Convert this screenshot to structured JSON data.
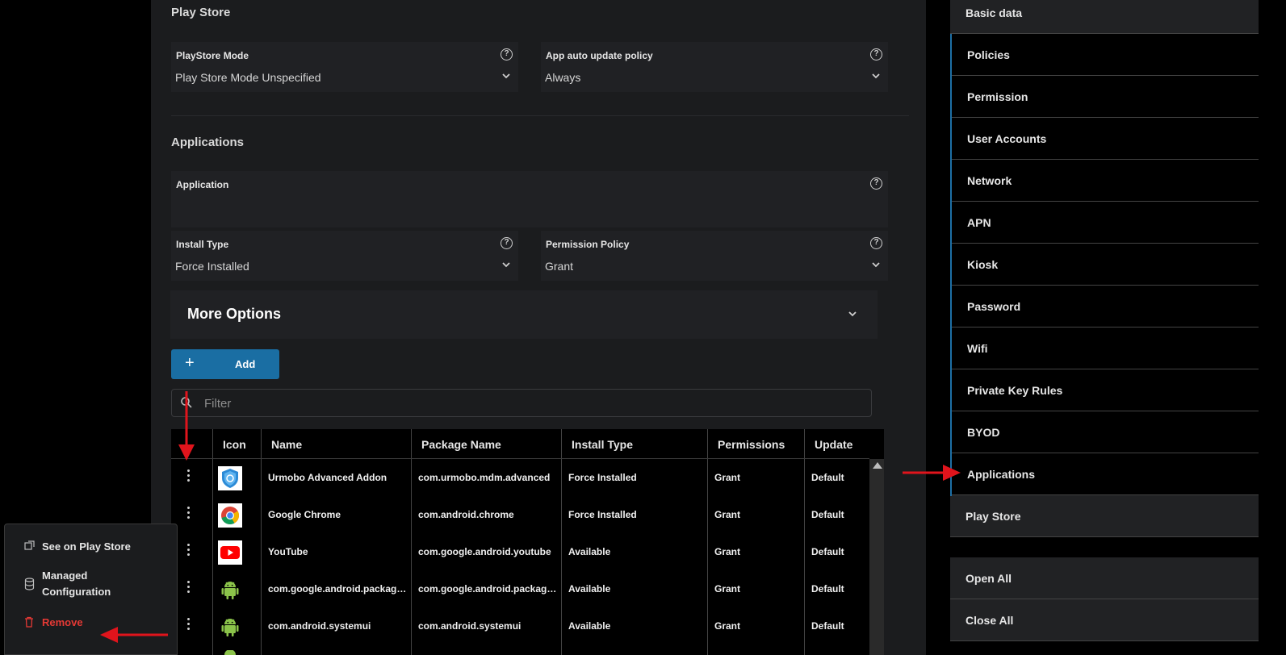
{
  "playstore_section": {
    "title": "Play Store",
    "mode": {
      "label": "PlayStore Mode",
      "value": "Play Store Mode Unspecified"
    },
    "auto_update": {
      "label": "App auto update policy",
      "value": "Always"
    }
  },
  "applications_section": {
    "title": "Applications",
    "application": {
      "label": "Application",
      "value": ""
    },
    "install_type": {
      "label": "Install Type",
      "value": "Force Installed"
    },
    "permission_policy": {
      "label": "Permission Policy",
      "value": "Grant"
    },
    "more_options_label": "More Options",
    "add_label": "Add",
    "filter_placeholder": "Filter"
  },
  "table": {
    "columns": [
      "Icon",
      "Name",
      "Package Name",
      "Install Type",
      "Permissions",
      "Update"
    ],
    "rows": [
      {
        "icon": "shield-icon",
        "name": "Urmobo Advanced Addon",
        "package": "com.urmobo.mdm.advanced",
        "install": "Force Installed",
        "permissions": "Grant",
        "update": "Default"
      },
      {
        "icon": "chrome-icon",
        "name": "Google Chrome",
        "package": "com.android.chrome",
        "install": "Force Installed",
        "permissions": "Grant",
        "update": "Default"
      },
      {
        "icon": "youtube-icon",
        "name": "YouTube",
        "package": "com.google.android.youtube",
        "install": "Available",
        "permissions": "Grant",
        "update": "Default"
      },
      {
        "icon": "android-icon",
        "name": "com.google.android.packagei...",
        "package": "com.google.android.packagei...",
        "install": "Available",
        "permissions": "Grant",
        "update": "Default"
      },
      {
        "icon": "android-icon",
        "name": "com.android.systemui",
        "package": "com.android.systemui",
        "install": "Available",
        "permissions": "Grant",
        "update": "Default"
      }
    ]
  },
  "sidebar": {
    "items": [
      {
        "label": "Basic data"
      },
      {
        "label": "Policies"
      },
      {
        "label": "Permission"
      },
      {
        "label": "User Accounts"
      },
      {
        "label": "Network"
      },
      {
        "label": "APN"
      },
      {
        "label": "Kiosk"
      },
      {
        "label": "Password"
      },
      {
        "label": "Wifi"
      },
      {
        "label": "Private Key Rules"
      },
      {
        "label": "BYOD"
      },
      {
        "label": "Applications"
      },
      {
        "label": "Play Store"
      }
    ],
    "open_all": "Open All",
    "close_all": "Close All"
  },
  "context_menu": {
    "see_on_play_store": "See on Play Store",
    "managed_configuration_line1": "Managed",
    "managed_configuration_line2": "Configuration",
    "remove": "Remove"
  },
  "colors": {
    "accent_blue": "#1a6ea3",
    "danger_red": "#e53935",
    "annotation_red": "#e0141c"
  }
}
